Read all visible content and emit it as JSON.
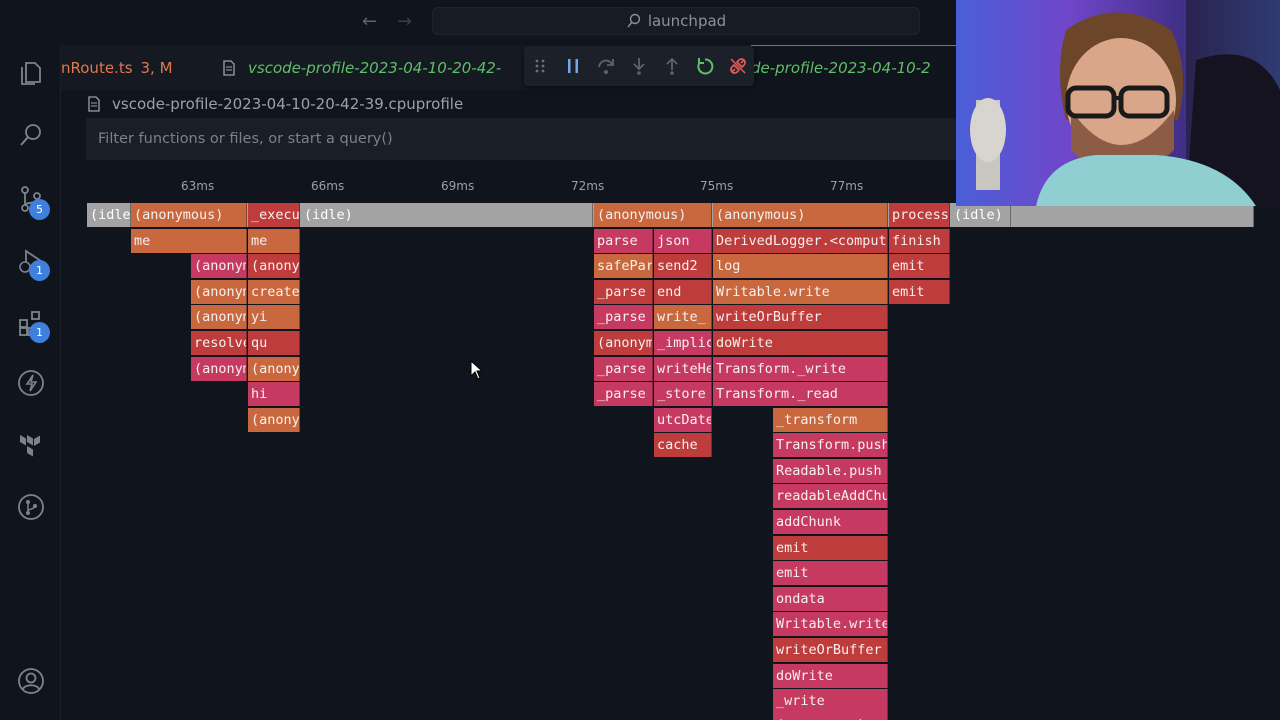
{
  "titlebar": {
    "search_text": "launchpad"
  },
  "activity_badges": {
    "source_control": "5",
    "run_debug": "1",
    "extensions": "1"
  },
  "tabs": [
    {
      "label": "nRoute.ts",
      "status": "3, M"
    },
    {
      "label": "vscode-profile-2023-04-10-20-42-"
    },
    {
      "label": "de-profile-2023-04-10-2"
    }
  ],
  "breadcrumb": {
    "file": "vscode-profile-2023-04-10-20-42-39.cpuprofile"
  },
  "filter": {
    "placeholder": "Filter functions or files, or start a query()"
  },
  "timeline": {
    "ticks": [
      "63ms",
      "66ms",
      "69ms",
      "72ms",
      "75ms",
      "77ms"
    ]
  },
  "flame": {
    "r0": [
      "(idle)",
      "(anonymous)",
      "_execute",
      "(idle)",
      "(anonymous)",
      "(anonymous)",
      "process",
      "(idle)"
    ],
    "r1": [
      "me",
      "me",
      "parse",
      "json",
      "DerivedLogger.<computed>",
      "finish"
    ],
    "r2": [
      "(anonymous)",
      "(anonymous)",
      "safeParse",
      "send2",
      "log",
      "emit"
    ],
    "r3": [
      "(anonymous)",
      "create",
      "_parse",
      "end",
      "Writable.write",
      "emit"
    ],
    "r4": [
      "(anonymous)",
      "yi",
      "_parse",
      "write_",
      "writeOrBuffer"
    ],
    "r5": [
      "resolve",
      "qu",
      "(anonymous)",
      "_implicit",
      "doWrite"
    ],
    "r6": [
      "(anonymous)",
      "(anonymous)",
      "_parse",
      "writeHead",
      "Transform._write"
    ],
    "r7": [
      "hi",
      "_parse",
      "_store",
      "Transform._read"
    ],
    "r8": [
      "(anonymous)",
      "utcDate",
      "_transform"
    ],
    "r9": [
      "cache",
      "Transform.push"
    ],
    "r10": [
      "Readable.push"
    ],
    "r11": [
      "readableAddChunk"
    ],
    "r12": [
      "addChunk"
    ],
    "r13": [
      "emit"
    ],
    "r14": [
      "emit"
    ],
    "r15": [
      "ondata"
    ],
    "r16": [
      "Writable.write"
    ],
    "r17": [
      "writeOrBuffer"
    ],
    "r18": [
      "doWrite"
    ],
    "r19": [
      "_write"
    ],
    "r20": [
      "(anonymous)"
    ]
  },
  "colors": {
    "idle": "#a3a3a3",
    "orange": "#c9683e",
    "red": "#bf3c3c",
    "pink": "#c63a62",
    "accent_green": "#5fbf69",
    "badge_blue": "#3f7fdd"
  }
}
